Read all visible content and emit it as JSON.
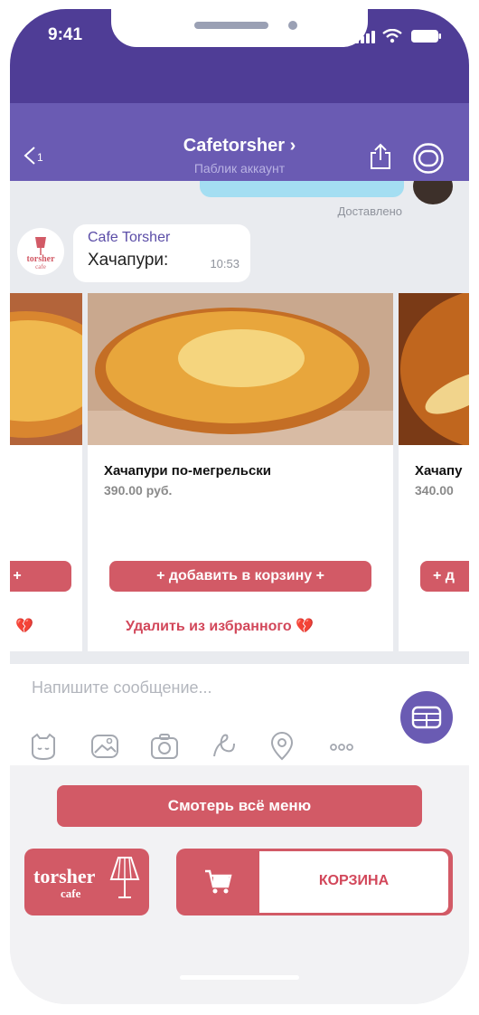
{
  "status": {
    "time": "9:41"
  },
  "header": {
    "back_count": "1",
    "title": "Cafetorsher ›",
    "subtitle": "Паблик аккаунт"
  },
  "chat": {
    "delivered": "Доставлено",
    "message": {
      "sender": "Cafe Torsher",
      "text": "Хачапури:",
      "time": "10:53"
    },
    "avatar_logo": {
      "line1": "torsher",
      "line2": "cafe"
    }
  },
  "carousel": {
    "cards": [
      {
        "name": "",
        "price": "",
        "add_label": "+",
        "remove_label": "💔"
      },
      {
        "name": "Хачапури по-мегрельски",
        "price": "390.00 руб.",
        "add_label": "+ добавить в корзину +",
        "remove_label": "Удалить из избранного 💔"
      },
      {
        "name": "Хачапу",
        "price": "340.00",
        "add_label": "+ д",
        "remove_label": ""
      }
    ]
  },
  "input": {
    "placeholder": "Напишите сообщение..."
  },
  "keyboard": {
    "all_menu_label": "Смотерь всё меню",
    "logo": {
      "line1": "torsher",
      "line2": "cafe"
    },
    "cart_label": "КОРЗИНА"
  },
  "colors": {
    "header_purple": "#6a5bb3",
    "status_purple": "#4f3d96",
    "accent_red": "#d25a66",
    "sender_purple": "#5b4da7"
  }
}
